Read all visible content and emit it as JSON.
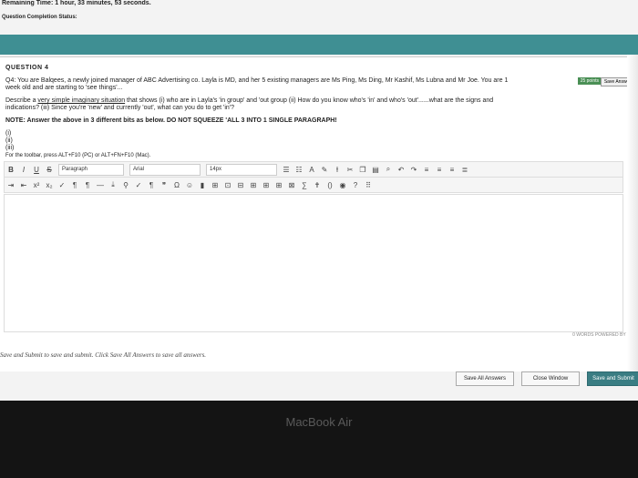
{
  "header": {
    "timer_text": "Remaining Time: 1 hour, 33 minutes, 53 seconds.",
    "status_text": "Question Completion Status:"
  },
  "question": {
    "heading": "QUESTION 4",
    "points_badge": "25 points",
    "save_answer_label": "Save Answer",
    "word_count_top": "0 WORDS POWERED BY TINY",
    "line1": "Q4: You are Balqees, a newly joined manager of ABC Advertising co. Layla is MD, and her 5 existing managers are Ms Ping, Ms Ding, Mr Kashif, Ms Lubna and Mr Joe. You are 1",
    "line2": "week old and are starting to 'see things'...",
    "line3_prefix": "Describe a ",
    "line3_underline": "very simple imaginary situation",
    "line3_suffix": " that shows (i) who are in Layla's 'in group' and 'out group (ii) How do you know who's 'in' and who's 'out'......what are the signs and",
    "line4": "indications? (iii) Since you're 'new' and currently 'out', what can you do to get 'in'?",
    "note": "NOTE: Answer the above in 3 different bits as below. DO NOT SQUEEZE 'ALL 3 INTO 1 SINGLE PARAGRAPH!",
    "items": [
      "(i)",
      "(ii)",
      "(iii)"
    ],
    "toolbar_hint": "For the toolbar, press ALT+F10 (PC) or ALT+FN+F10 (Mac)."
  },
  "editor": {
    "paragraph_select": "Paragraph",
    "font_select": "Arial",
    "size_select": "14px",
    "word_count": "0 WORDS POWERED BY TIN"
  },
  "footer": {
    "instruction": "Save and Submit to save and submit. Click Save All Answers to save all answers.",
    "save_all_label": "Save All Answers",
    "close_window_label": "Close Window",
    "save_submit_label": "Save and Submit"
  },
  "device": {
    "label": "MacBook Air"
  }
}
